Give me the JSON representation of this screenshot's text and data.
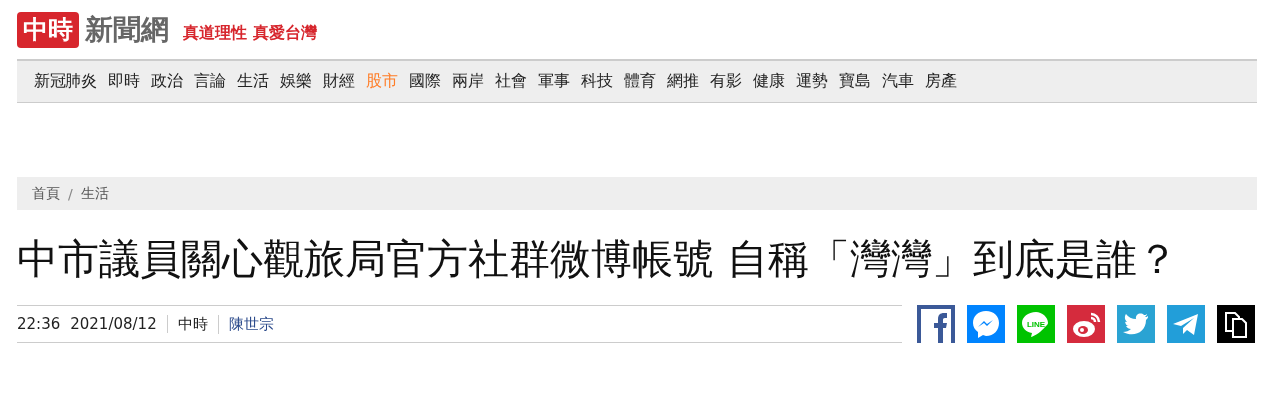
{
  "header": {
    "logo_mark": "中時",
    "logo_text": "新聞網",
    "slogan": "真道理性 真愛台灣"
  },
  "nav": [
    {
      "label": "新冠肺炎",
      "selected": false
    },
    {
      "label": "即時",
      "selected": false
    },
    {
      "label": "政治",
      "selected": false
    },
    {
      "label": "言論",
      "selected": false
    },
    {
      "label": "生活",
      "selected": false
    },
    {
      "label": "娛樂",
      "selected": false
    },
    {
      "label": "財經",
      "selected": false
    },
    {
      "label": "股市",
      "selected": true
    },
    {
      "label": "國際",
      "selected": false
    },
    {
      "label": "兩岸",
      "selected": false
    },
    {
      "label": "社會",
      "selected": false
    },
    {
      "label": "軍事",
      "selected": false
    },
    {
      "label": "科技",
      "selected": false
    },
    {
      "label": "體育",
      "selected": false
    },
    {
      "label": "網推",
      "selected": false
    },
    {
      "label": "有影",
      "selected": false
    },
    {
      "label": "健康",
      "selected": false
    },
    {
      "label": "運勢",
      "selected": false
    },
    {
      "label": "寶島",
      "selected": false
    },
    {
      "label": "汽車",
      "selected": false
    },
    {
      "label": "房產",
      "selected": false
    }
  ],
  "breadcrumb": [
    "首頁",
    "/",
    "生活"
  ],
  "article": {
    "title": "中市議員關心觀旅局官方社群微博帳號 自稱「灣灣」到底是誰？",
    "time": "22:36",
    "date": "2021/08/12",
    "source": "中時",
    "author": "陳世宗"
  },
  "share": [
    {
      "kind": "facebook",
      "color": "#3b5998"
    },
    {
      "kind": "messenger",
      "color": "#0084ff"
    },
    {
      "kind": "line",
      "color": "#00c300",
      "label": "LINE"
    },
    {
      "kind": "weibo",
      "color": "#d52b3d"
    },
    {
      "kind": "twitter",
      "color": "#2aa3d3"
    },
    {
      "kind": "telegram",
      "color": "#229ed9"
    },
    {
      "kind": "copy",
      "color": "#000000"
    }
  ]
}
